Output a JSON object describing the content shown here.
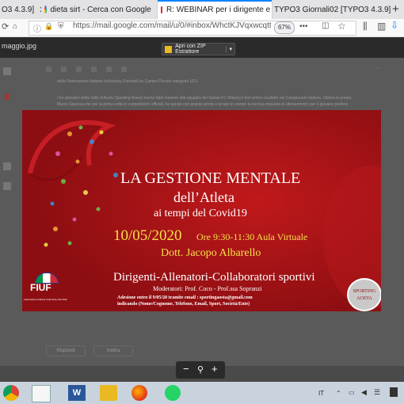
{
  "tabs": [
    {
      "label": "O3 4.3.9]",
      "active": false
    },
    {
      "label": "dieta sirt - Cerca con Google",
      "active": false
    },
    {
      "label": "R: WEBINAR per i dirigente e",
      "active": true
    },
    {
      "label": "TYPO3 Giornali02 [TYPO3 4.3.9]",
      "active": false
    }
  ],
  "new_tab_label": "+",
  "nav": {
    "url": "https://mail.google.com/mail/u/0/#inbox/WhctKJVqxwcqttW",
    "zoom": "67%"
  },
  "viewer": {
    "filename": "maggio.jpg",
    "zip_button": "Apri con ZIP Estrattore",
    "email_line1": "della Federazione Italiana Unihockey Floorball su Campo Piccolo categoria U13.",
    "email_line2": "I tre giocatori della Valle d'Aosta (Sporting Aosta) hanno fatto insieme alla squadra dei Giants-FC Milano) il loro primo scudetto nel Campionato Italiano. Ottima la presta",
    "email_line3": "Marco Giacosa che per la prima volta in competizioni ufficiali, ha parato con grande grinta e tenuto in campo la tecnica imparata in allenamento; per il giovane portiere",
    "reply": "Rispondi",
    "forward": "Inoltra"
  },
  "poster": {
    "title1": "LA GESTIONE MENTALE",
    "title2": "dell’Atleta",
    "title3": "ai tempi del Covid19",
    "date": "10/05/2020",
    "time": "Ore 9:30-11:30 Aula Virtuale",
    "speaker": "Dott. Jacopo Albarello",
    "audience": "Dirigenti-Allenatori-Collaboratori sportivi",
    "moderators": "Moderatori: Prof. Coco - Prof.ssa Sopranzi",
    "signup1": "Adesione entro il 9/05/20 tramite email : sportingaosta@gmail.com",
    "signup2": "indicando (Nome/Cognome, Telefono, Email, Sport, Società/Ente)",
    "fiuf_logo": "FIUF",
    "fiuf_sub": "Federazione Italiana Unihockey Floorball",
    "sporting_logo1": "SPORTING",
    "sporting_logo2": "AOSTA"
  },
  "zoom_controls": {
    "minus": "−",
    "search": "⚲",
    "plus": "+"
  },
  "taskbar": {
    "lang": "IT"
  },
  "colors": {
    "poster_bg": "#a31215",
    "title_white": "#ffffff",
    "date_yellow": "#f5e04a",
    "tab_accent": "#0a84ff"
  }
}
